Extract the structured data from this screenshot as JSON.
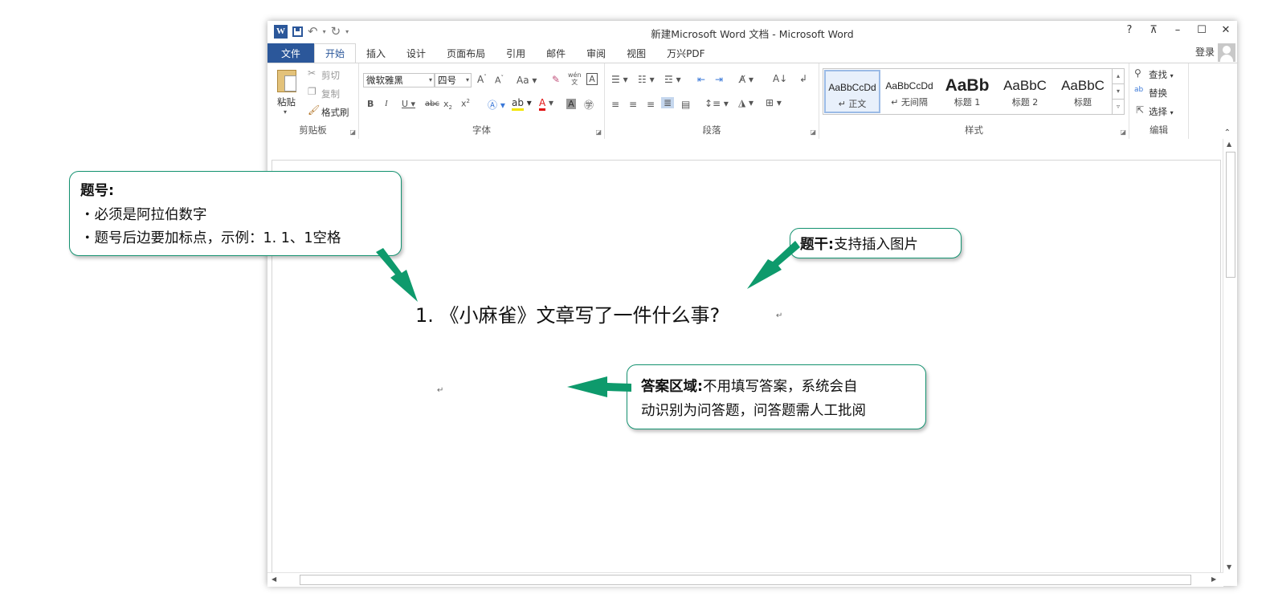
{
  "window": {
    "title": "新建Microsoft Word 文档 - Microsoft Word",
    "logo": "W",
    "controls": [
      "?",
      "⊼",
      "–",
      "☐",
      "✕"
    ]
  },
  "tabs": [
    "文件",
    "开始",
    "插入",
    "设计",
    "页面布局",
    "引用",
    "邮件",
    "审阅",
    "视图",
    "万兴PDF"
  ],
  "account": {
    "login": "登录"
  },
  "ribbon": {
    "clipboard": {
      "label": "剪贴板",
      "paste": "粘贴",
      "cut": "剪切",
      "copy": "复制",
      "format_painter": "格式刷"
    },
    "font": {
      "label": "字体",
      "font_name": "微软雅黑",
      "font_size": "四号",
      "change_case": "Aa",
      "pinyin": "wén"
    },
    "paragraph": {
      "label": "段落"
    },
    "styles": {
      "label": "样式",
      "items": [
        {
          "sample": "AaBbCcDd",
          "name": "↵ 正文"
        },
        {
          "sample": "AaBbCcDd",
          "name": "↵ 无间隔"
        },
        {
          "sample": "AaBb",
          "name": "标题 1"
        },
        {
          "sample": "AaBbC",
          "name": "标题 2"
        },
        {
          "sample": "AaBbC",
          "name": "标题"
        }
      ]
    },
    "editing": {
      "label": "编辑",
      "find": "查找",
      "replace": "替换",
      "select": "选择"
    }
  },
  "document": {
    "question": "1. 《小麻雀》文章写了一件什么事?",
    "paragraph_mark": "↵"
  },
  "callouts": {
    "number": {
      "title": "题号:",
      "line1": "・必须是阿拉伯数字",
      "line2": "・题号后边要加标点，示例：1. 1、1空格"
    },
    "stem": {
      "title": "题干:",
      "text": "支持插入图片"
    },
    "answer": {
      "title": "答案区域:",
      "text1": "不用填写答案，系统会自",
      "text2": "动识别为问答题，问答题需人工批阅"
    }
  },
  "colors": {
    "accent": "#2b579a",
    "callout_border": "#149270",
    "arrow": "#0e9a6c"
  }
}
